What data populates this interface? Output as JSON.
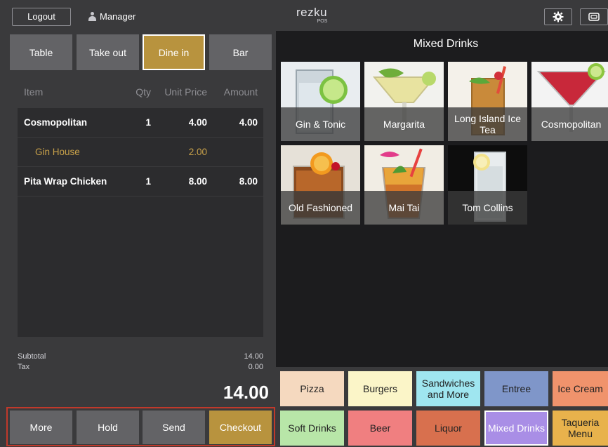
{
  "header": {
    "logout_label": "Logout",
    "user_label": "Manager",
    "logo_main": "rezku",
    "logo_sub": "POS"
  },
  "order_types": [
    {
      "label": "Table",
      "active": false
    },
    {
      "label": "Take out",
      "active": false
    },
    {
      "label": "Dine in",
      "active": true
    },
    {
      "label": "Bar",
      "active": false
    }
  ],
  "order": {
    "columns": {
      "item": "Item",
      "qty": "Qty",
      "unit_price": "Unit Price",
      "amount": "Amount"
    },
    "rows": [
      {
        "item": "Cosmopolitan",
        "qty": "1",
        "unit_price": "4.00",
        "amount": "4.00",
        "modifier": false
      },
      {
        "item": "Gin House",
        "qty": "",
        "unit_price": "2.00",
        "amount": "",
        "modifier": true
      },
      {
        "item": "Pita Wrap Chicken",
        "qty": "1",
        "unit_price": "8.00",
        "amount": "8.00",
        "modifier": false
      }
    ],
    "subtotal_label": "Subtotal",
    "subtotal_value": "14.00",
    "tax_label": "Tax",
    "tax_value": "0.00",
    "total": "14.00"
  },
  "actions": [
    {
      "label": "More"
    },
    {
      "label": "Hold"
    },
    {
      "label": "Send"
    },
    {
      "label": "Checkout"
    }
  ],
  "menu": {
    "category_title": "Mixed Drinks",
    "items": [
      {
        "label": "Gin & Tonic",
        "icon": "gin-tonic-image"
      },
      {
        "label": "Margarita",
        "icon": "margarita-image"
      },
      {
        "label": "Long Island Ice Tea",
        "icon": "long-island-image"
      },
      {
        "label": "Cosmopolitan",
        "icon": "cosmopolitan-image"
      },
      {
        "label": "Old Fashioned",
        "icon": "old-fashioned-image"
      },
      {
        "label": "Mai Tai",
        "icon": "mai-tai-image"
      },
      {
        "label": "Tom Collins",
        "icon": "tom-collins-image"
      }
    ]
  },
  "categories": [
    {
      "label": "Pizza",
      "color": "#f5d9bf"
    },
    {
      "label": "Burgers",
      "color": "#fbf5c8"
    },
    {
      "label": "Sandwiches and More",
      "color": "#9fe6f0"
    },
    {
      "label": "Entree",
      "color": "#7f96c9"
    },
    {
      "label": "Ice Cream",
      "color": "#f0936c"
    },
    {
      "label": "Soft Drinks",
      "color": "#b8e6a8"
    },
    {
      "label": "Beer",
      "color": "#f07f80"
    },
    {
      "label": "Liquor",
      "color": "#d8704e"
    },
    {
      "label": "Mixed Drinks",
      "color": "#a98ee6",
      "selected": true
    },
    {
      "label": "Taqueria Menu",
      "color": "#e8b24c"
    }
  ]
}
